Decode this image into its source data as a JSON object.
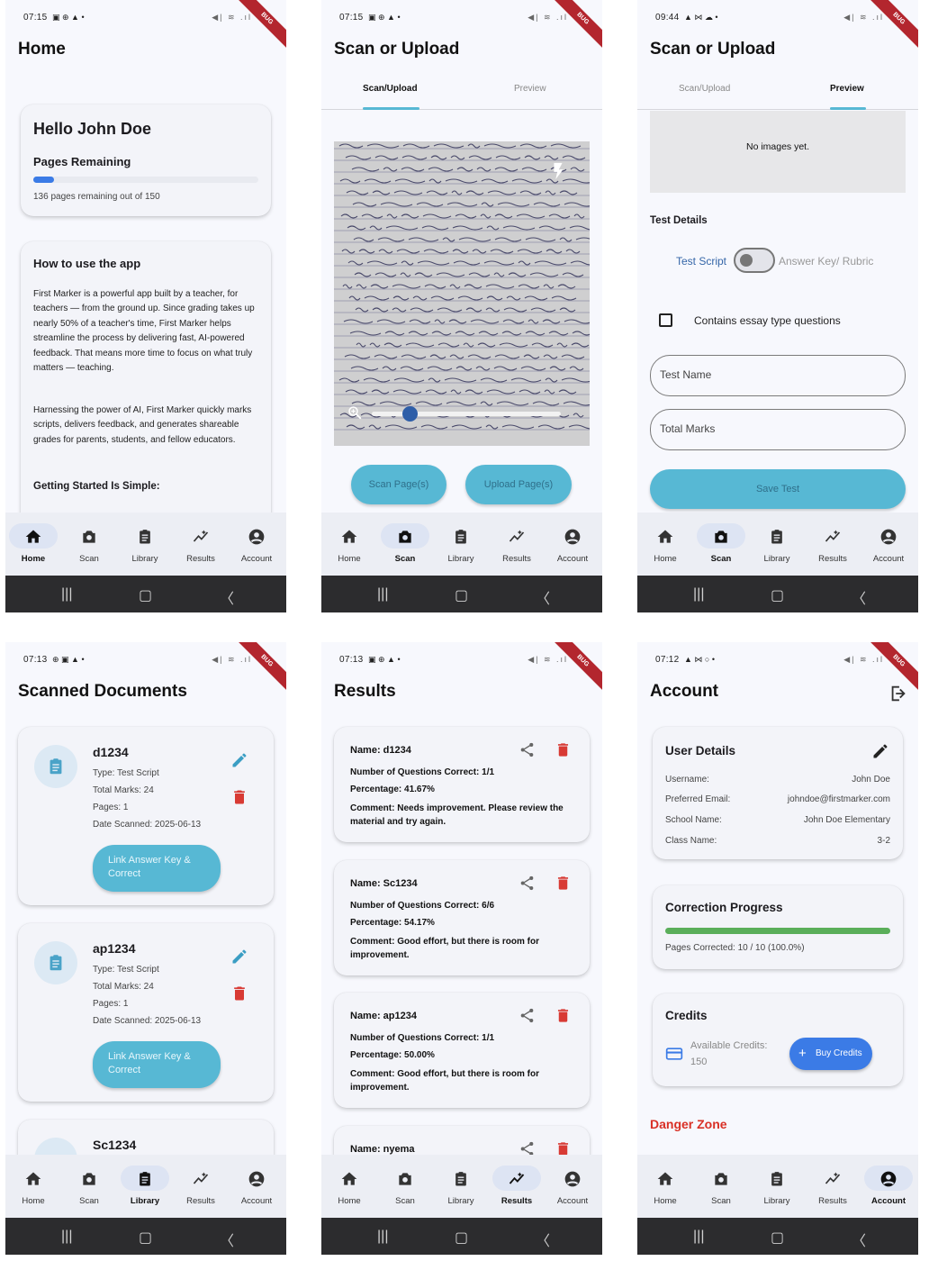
{
  "nav": [
    "Home",
    "Scan",
    "Library",
    "Results",
    "Account"
  ],
  "ribbon": "BUG",
  "status_icons": "◀| ≋ .ıl",
  "colors": {
    "accent": "#57b8d4",
    "progress_blue": "#3b7be6",
    "progress_green": "#5aae5a",
    "danger": "#d93025",
    "delete_red": "#d83a34"
  },
  "screen1": {
    "time": "07:15",
    "title": "Home",
    "greeting": "Hello John Doe",
    "pages_heading": "Pages Remaining",
    "pages_fraction": 0.093,
    "pages_text": "136 pages remaining out of 150",
    "howto_heading": "How to use the app",
    "para1": "First Marker is a powerful app built by a teacher, for teachers — from the ground up. Since grading takes up nearly 50% of a teacher's time, First Marker helps streamline the process by delivering fast, AI-powered feedback. That means more time to focus on what truly matters — teaching.",
    "para2": "Harnessing the power of AI, First Marker quickly marks scripts, delivers feedback, and generates shareable grades for parents, students, and fellow educators.",
    "getting_started": "Getting Started Is Simple:"
  },
  "screen2": {
    "time": "07:15",
    "title": "Scan or Upload",
    "tab1": "Scan/Upload",
    "tab2": "Preview",
    "zoom_level": 0.2,
    "scan_btn": "Scan Page(s)",
    "upload_btn": "Upload Page(s)"
  },
  "screen3": {
    "time": "09:44",
    "title": "Scan or Upload",
    "tab1": "Scan/Upload",
    "tab2": "Preview",
    "no_images": "No images yet.",
    "test_details": "Test Details",
    "toggle_left": "Test Script",
    "toggle_right": "Answer Key/ Rubric",
    "essay_label": "Contains essay type questions",
    "test_name_ph": "Test Name",
    "total_marks_ph": "Total Marks",
    "save_btn": "Save Test"
  },
  "screen4": {
    "time": "07:13",
    "title": "Scanned Documents",
    "docs": [
      {
        "name": "d1234",
        "type": "Type: Test Script",
        "marks": "Total Marks: 24",
        "pages": "Pages: 1",
        "date": "Date Scanned: 2025-06-13",
        "btn": "Link Answer Key & Correct"
      },
      {
        "name": "ap1234",
        "type": "Type: Test Script",
        "marks": "Total Marks: 24",
        "pages": "Pages: 1",
        "date": "Date Scanned: 2025-06-13",
        "btn": "Link Answer Key & Correct"
      },
      {
        "name": "Sc1234"
      }
    ]
  },
  "screen5": {
    "time": "07:13",
    "title": "Results",
    "results": [
      {
        "name": "Name: d1234",
        "questions": "Number of Questions Correct: 1/1",
        "percentage": "Percentage: 41.67%",
        "comment": "Comment: Needs improvement. Please review the material and try again."
      },
      {
        "name": "Name: Sc1234",
        "questions": "Number of Questions Correct: 6/6",
        "percentage": "Percentage: 54.17%",
        "comment": "Comment: Good effort, but there is room for improvement."
      },
      {
        "name": "Name: ap1234",
        "questions": "Number of Questions Correct: 1/1",
        "percentage": "Percentage: 50.00%",
        "comment": "Comment: Good effort, but there is room for improvement."
      },
      {
        "name": "Name: nyema"
      }
    ]
  },
  "screen6": {
    "time": "07:12",
    "title": "Account",
    "user_details": "User Details",
    "rows": [
      {
        "label": "Username:",
        "value": "John Doe"
      },
      {
        "label": "Preferred Email:",
        "value": "johndoe@firstmarker.com"
      },
      {
        "label": "School Name:",
        "value": "John Doe Elementary"
      },
      {
        "label": "Class Name:",
        "value": "3-2"
      }
    ],
    "correction_heading": "Correction Progress",
    "correction_fraction": 1.0,
    "correction_text": "Pages Corrected: 10 / 10 (100.0%)",
    "credits_heading": "Credits",
    "available_label": "Available Credits:",
    "available_value": "150",
    "buy_btn": "Buy Credits",
    "danger_zone": "Danger Zone"
  }
}
